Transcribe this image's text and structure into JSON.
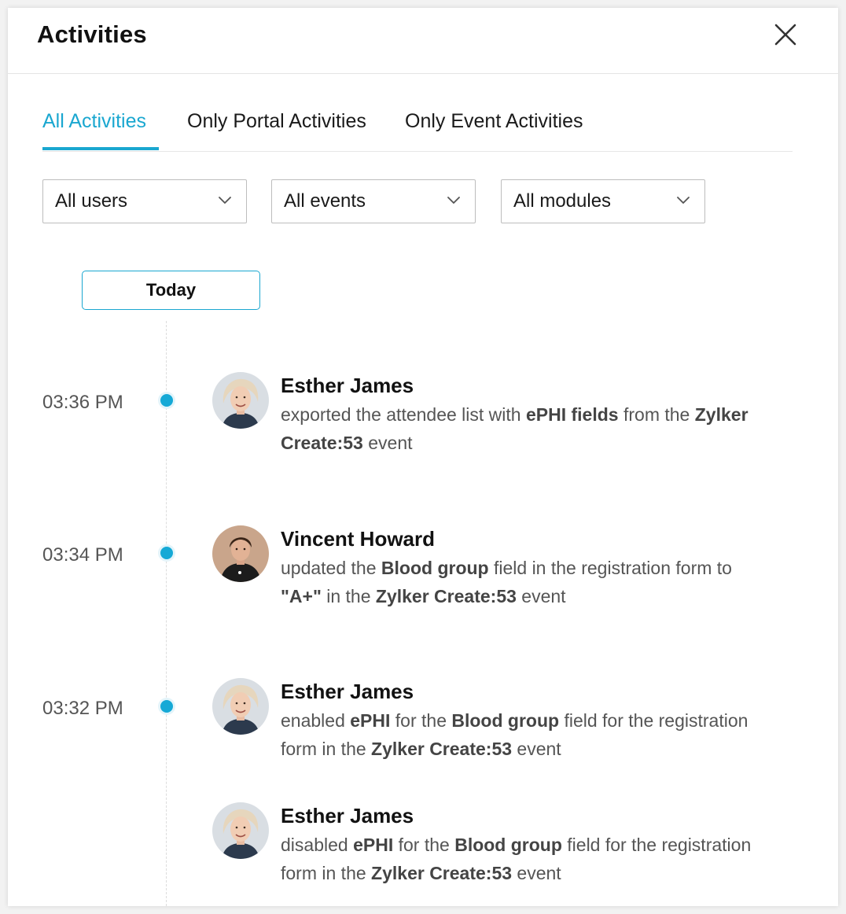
{
  "header": {
    "title": "Activities"
  },
  "tabs": [
    {
      "label": "All Activities",
      "active": true
    },
    {
      "label": "Only Portal Activities",
      "active": false
    },
    {
      "label": "Only Event Activities",
      "active": false
    }
  ],
  "filters": [
    {
      "label": "All users"
    },
    {
      "label": "All events"
    },
    {
      "label": "All modules"
    }
  ],
  "date_group": "Today",
  "colors": {
    "accent": "#1aa7d0",
    "dot": "#15a9d6"
  },
  "activities": [
    {
      "time": "03:36 PM",
      "user": "Esther James",
      "avatar": "user-avatar-esther",
      "parts": [
        {
          "text": "exported the attendee list with "
        },
        {
          "text": "ePHI fields",
          "bold": true
        },
        {
          "text": " from the "
        },
        {
          "text": "Zylker Create:53",
          "bold": true
        },
        {
          "text": " event"
        }
      ]
    },
    {
      "time": "03:34 PM",
      "user": "Vincent Howard",
      "avatar": "user-avatar-vincent",
      "parts": [
        {
          "text": "updated the "
        },
        {
          "text": "Blood group",
          "bold": true
        },
        {
          "text": " field in the registration form to "
        },
        {
          "text": "\"A+\"",
          "bold": true
        },
        {
          "text": " in the "
        },
        {
          "text": "Zylker Create:53",
          "bold": true
        },
        {
          "text": " event"
        }
      ]
    },
    {
      "time": "03:32 PM",
      "user": "Esther James",
      "avatar": "user-avatar-esther",
      "parts": [
        {
          "text": "enabled "
        },
        {
          "text": "ePHI",
          "bold": true
        },
        {
          "text": " for the "
        },
        {
          "text": "Blood group",
          "bold": true
        },
        {
          "text": " field for the registration form in the "
        },
        {
          "text": "Zylker Create:53",
          "bold": true
        },
        {
          "text": " event"
        }
      ]
    },
    {
      "time": "",
      "user": "Esther James",
      "avatar": "user-avatar-esther",
      "parts": [
        {
          "text": "disabled "
        },
        {
          "text": "ePHI",
          "bold": true
        },
        {
          "text": " for the "
        },
        {
          "text": "Blood group",
          "bold": true
        },
        {
          "text": " field for the registration form in the "
        },
        {
          "text": "Zylker Create:53",
          "bold": true
        },
        {
          "text": " event"
        }
      ]
    }
  ]
}
